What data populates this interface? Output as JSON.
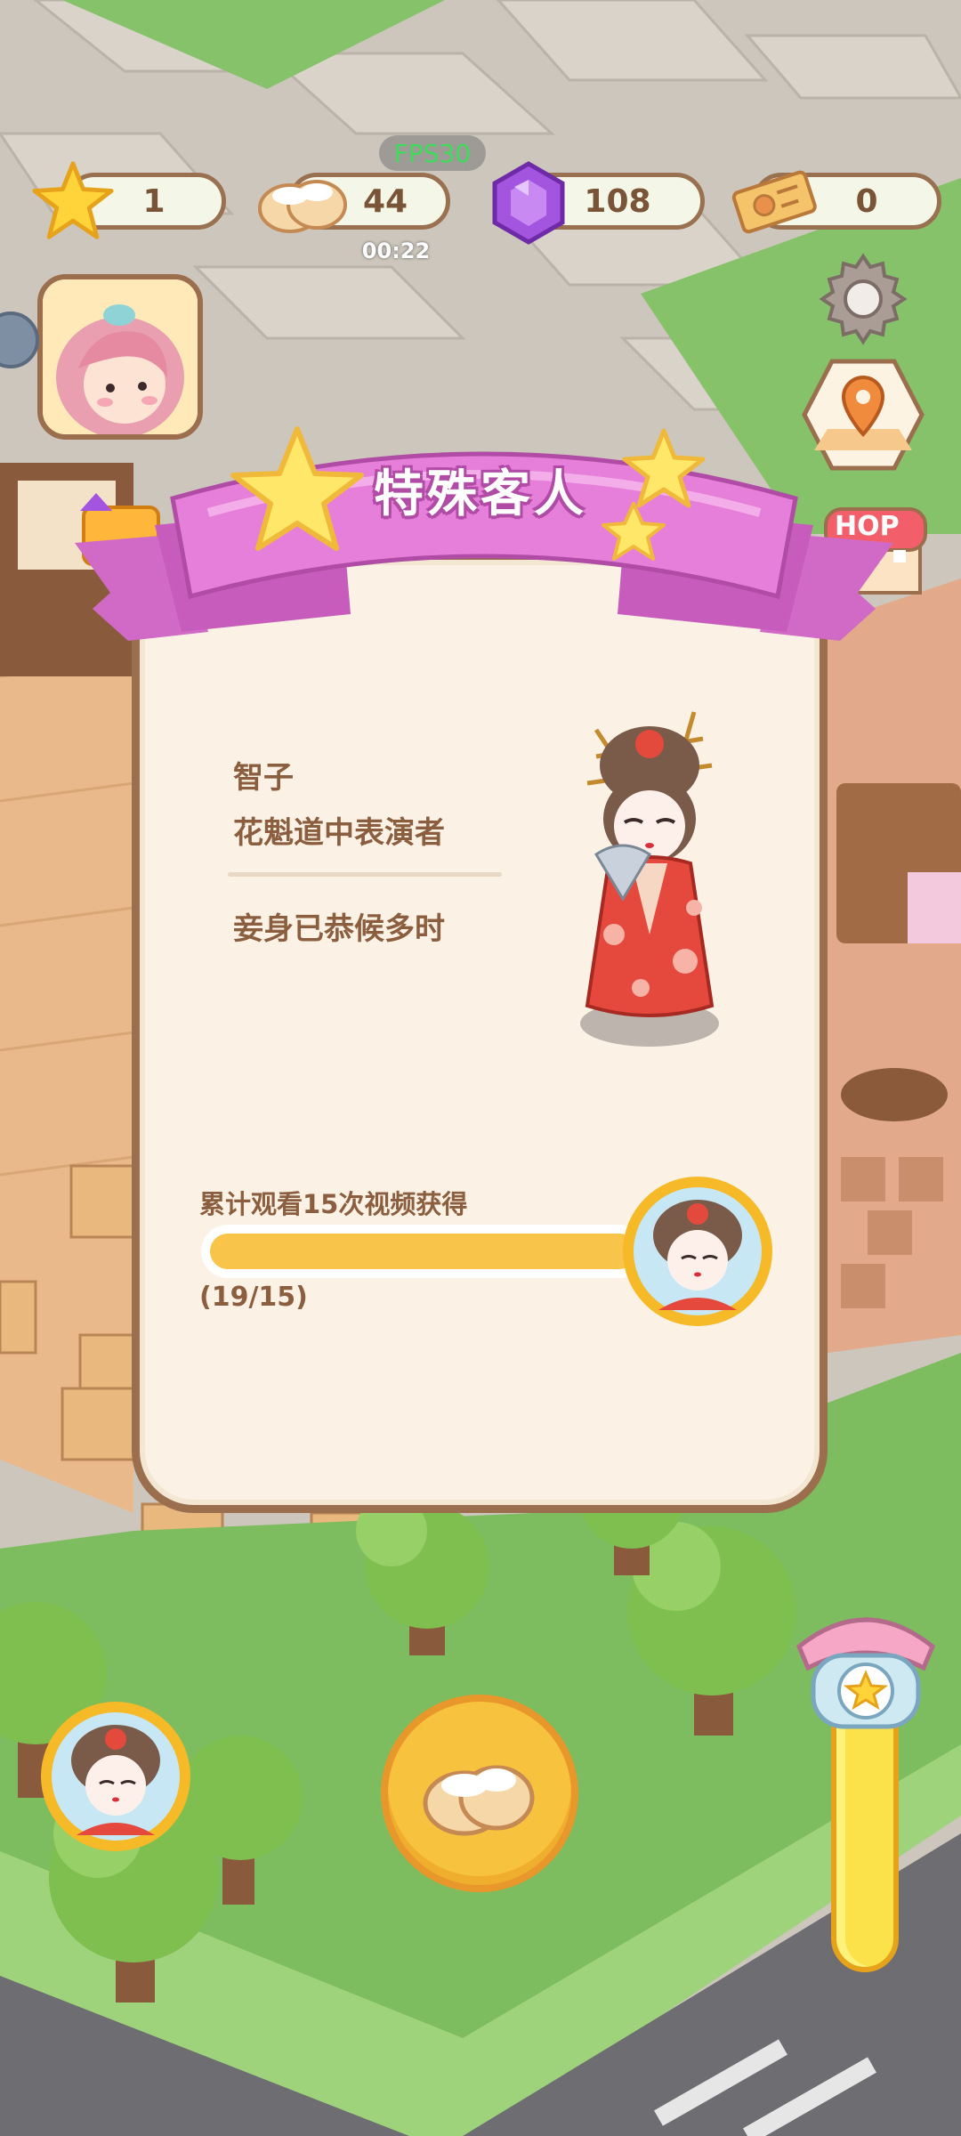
{
  "hud": {
    "stars": "1",
    "buns": "44",
    "gems": "108",
    "tickets": "0",
    "fps": "FPS30",
    "timer": "00:22"
  },
  "modal": {
    "title": "特殊客人",
    "character_name": "智子",
    "character_role": "花魁道中表演者",
    "character_quote": "妾身已恭候多时",
    "task_label": "累计观看15次视频获得",
    "progress_text": "(19/15)",
    "progress_fraction": 1.0
  },
  "shop_label": "HOP",
  "colors": {
    "ribbon": "#e67fd9",
    "ribbon_dark": "#c85cbd",
    "title_text": "#ffffff",
    "title_outline": "#b04ca5",
    "progress_fill": "#f8c54a",
    "panel_bg": "#fbf2e5",
    "panel_border": "#9b6e4d",
    "body_text": "#8b5e3f"
  },
  "icons": [
    "star-icon",
    "bun-icon",
    "gem-icon",
    "ticket-icon",
    "settings-gear-icon",
    "map-pin-icon",
    "shop-icon",
    "telephone-icon"
  ]
}
